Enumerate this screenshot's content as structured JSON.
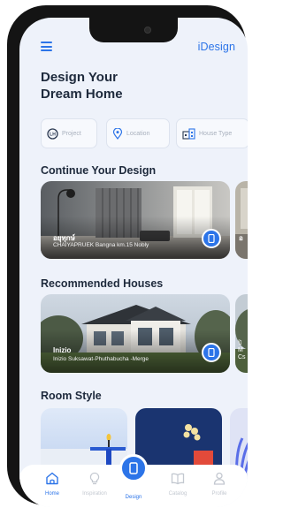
{
  "app": {
    "logo": "iDesign"
  },
  "hero": {
    "line1": "Design Your",
    "line2": "Dream Home"
  },
  "filters": [
    {
      "label": "Project",
      "icon": "project-icon"
    },
    {
      "label": "Location",
      "icon": "location-pin-icon"
    },
    {
      "label": "House Type",
      "icon": "house-type-icon"
    }
  ],
  "continue_design": {
    "title": "Continue Your Design",
    "card": {
      "title": "อยุทุกษ์",
      "subtitle": "CHAIYAPRUEK Bangna km.15 Nobly"
    },
    "peek": {
      "text": "อ"
    }
  },
  "recommended": {
    "title": "Recommended Houses",
    "card": {
      "title": "Inizio",
      "subtitle": "Inizio Suksawat-Phuthabucha -Merge"
    },
    "peek": {
      "line1": "ปิ",
      "line2": "M",
      "line3": "Cs"
    }
  },
  "room_style": {
    "title": "Room Style"
  },
  "tabbar": {
    "tabs": [
      {
        "label": "Home",
        "icon": "home-icon",
        "active": true
      },
      {
        "label": "Inspiration",
        "icon": "lightbulb-icon",
        "active": false
      },
      {
        "label": "Design",
        "icon": "phone-design-icon",
        "active": true
      },
      {
        "label": "Catalog",
        "icon": "book-icon",
        "active": false
      },
      {
        "label": "Profile",
        "icon": "person-icon",
        "active": false
      }
    ]
  },
  "colors": {
    "accent": "#2c74e8",
    "background": "#eef2fa",
    "text": "#1e2a3c",
    "muted": "#b6bcc6"
  }
}
